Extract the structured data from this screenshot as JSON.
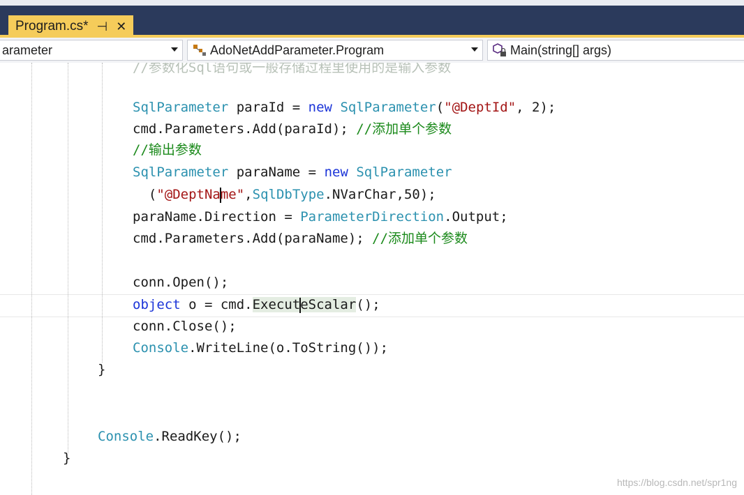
{
  "tab": {
    "title": "Program.cs*",
    "pin_glyph": "⊣",
    "close_glyph": "✕"
  },
  "nav": {
    "project_value": "arameter",
    "class_value": "AdoNetAddParameter.Program",
    "method_value": "Main(string[] args)"
  },
  "code": {
    "faded_comment": "//参数化Sql语句或一般存储过程里使用的是输入参数",
    "l1": {
      "t1": "SqlParameter",
      "t2": " paraId = ",
      "t3": "new",
      "t4": " ",
      "t5": "SqlParameter",
      "t6": "(",
      "t7": "\"@DeptId\"",
      "t8": ", 2);"
    },
    "l2": {
      "t1": "cmd.Parameters.Add(paraId); ",
      "t2": "//添加单个参数"
    },
    "l3": {
      "t1": "//输出参数"
    },
    "l4": {
      "t1": "SqlParameter",
      "t2": " paraName = ",
      "t3": "new",
      "t4": " ",
      "t5": "SqlParameter"
    },
    "l5": {
      "t1": "  (",
      "t2": "\"@DeptNa",
      "t3": "me\"",
      "t4": ",",
      "t5": "SqlDbType",
      "t6": ".NVarChar,50);"
    },
    "l6": {
      "t1": "paraName.Direction = ",
      "t2": "ParameterDirection",
      "t3": ".Output;"
    },
    "l7": {
      "t1": "cmd.Parameters.Add(paraName); ",
      "t2": "//添加单个参数"
    },
    "l8": {
      "t1": "conn.Open();"
    },
    "l9": {
      "t1": "object",
      "t2": " o = cmd.",
      "t3": "Execut",
      "t4": "eScalar",
      "t5": "();"
    },
    "l10": {
      "t1": "conn.Close();"
    },
    "l11": {
      "t1": "Console",
      "t2": ".WriteLine(o.ToString());"
    },
    "l12": {
      "t1": "}"
    },
    "l13": {
      "t1": "Console",
      "t2": ".ReadKey();"
    },
    "l14": {
      "t1": "}"
    }
  },
  "watermark": "https://blog.csdn.net/spr1ng",
  "colors": {
    "keyword": "#1b34d8",
    "type": "#2b91af",
    "string": "#a31515",
    "comment": "#1b8a1b",
    "tab_accent": "#f5cc5a",
    "tab_bar": "#2b3a5c"
  },
  "icons": {
    "class_dropdown": "class-member-icon",
    "method_dropdown": "method-lock-icon"
  }
}
